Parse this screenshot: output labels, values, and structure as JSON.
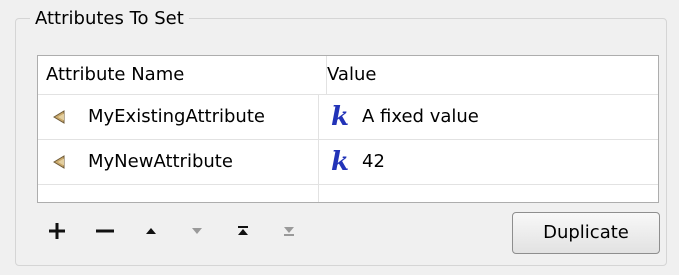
{
  "group": {
    "title": "Attributes To Set"
  },
  "table": {
    "columns": [
      "Attribute Name",
      "Value"
    ],
    "rows": [
      {
        "name": "MyExistingAttribute",
        "value": "A fixed value",
        "value_type_icon": "k"
      },
      {
        "name": "MyNewAttribute",
        "value": "42",
        "value_type_icon": "k"
      }
    ]
  },
  "toolbar": {
    "buttons": [
      "add-icon",
      "remove-icon",
      "move-up-icon",
      "move-down-icon",
      "move-to-top-icon",
      "move-to-bottom-icon"
    ],
    "duplicate_label": "Duplicate"
  },
  "colors": {
    "constant_icon": "#2233b8",
    "attribute_icon": "#c9a86a"
  }
}
